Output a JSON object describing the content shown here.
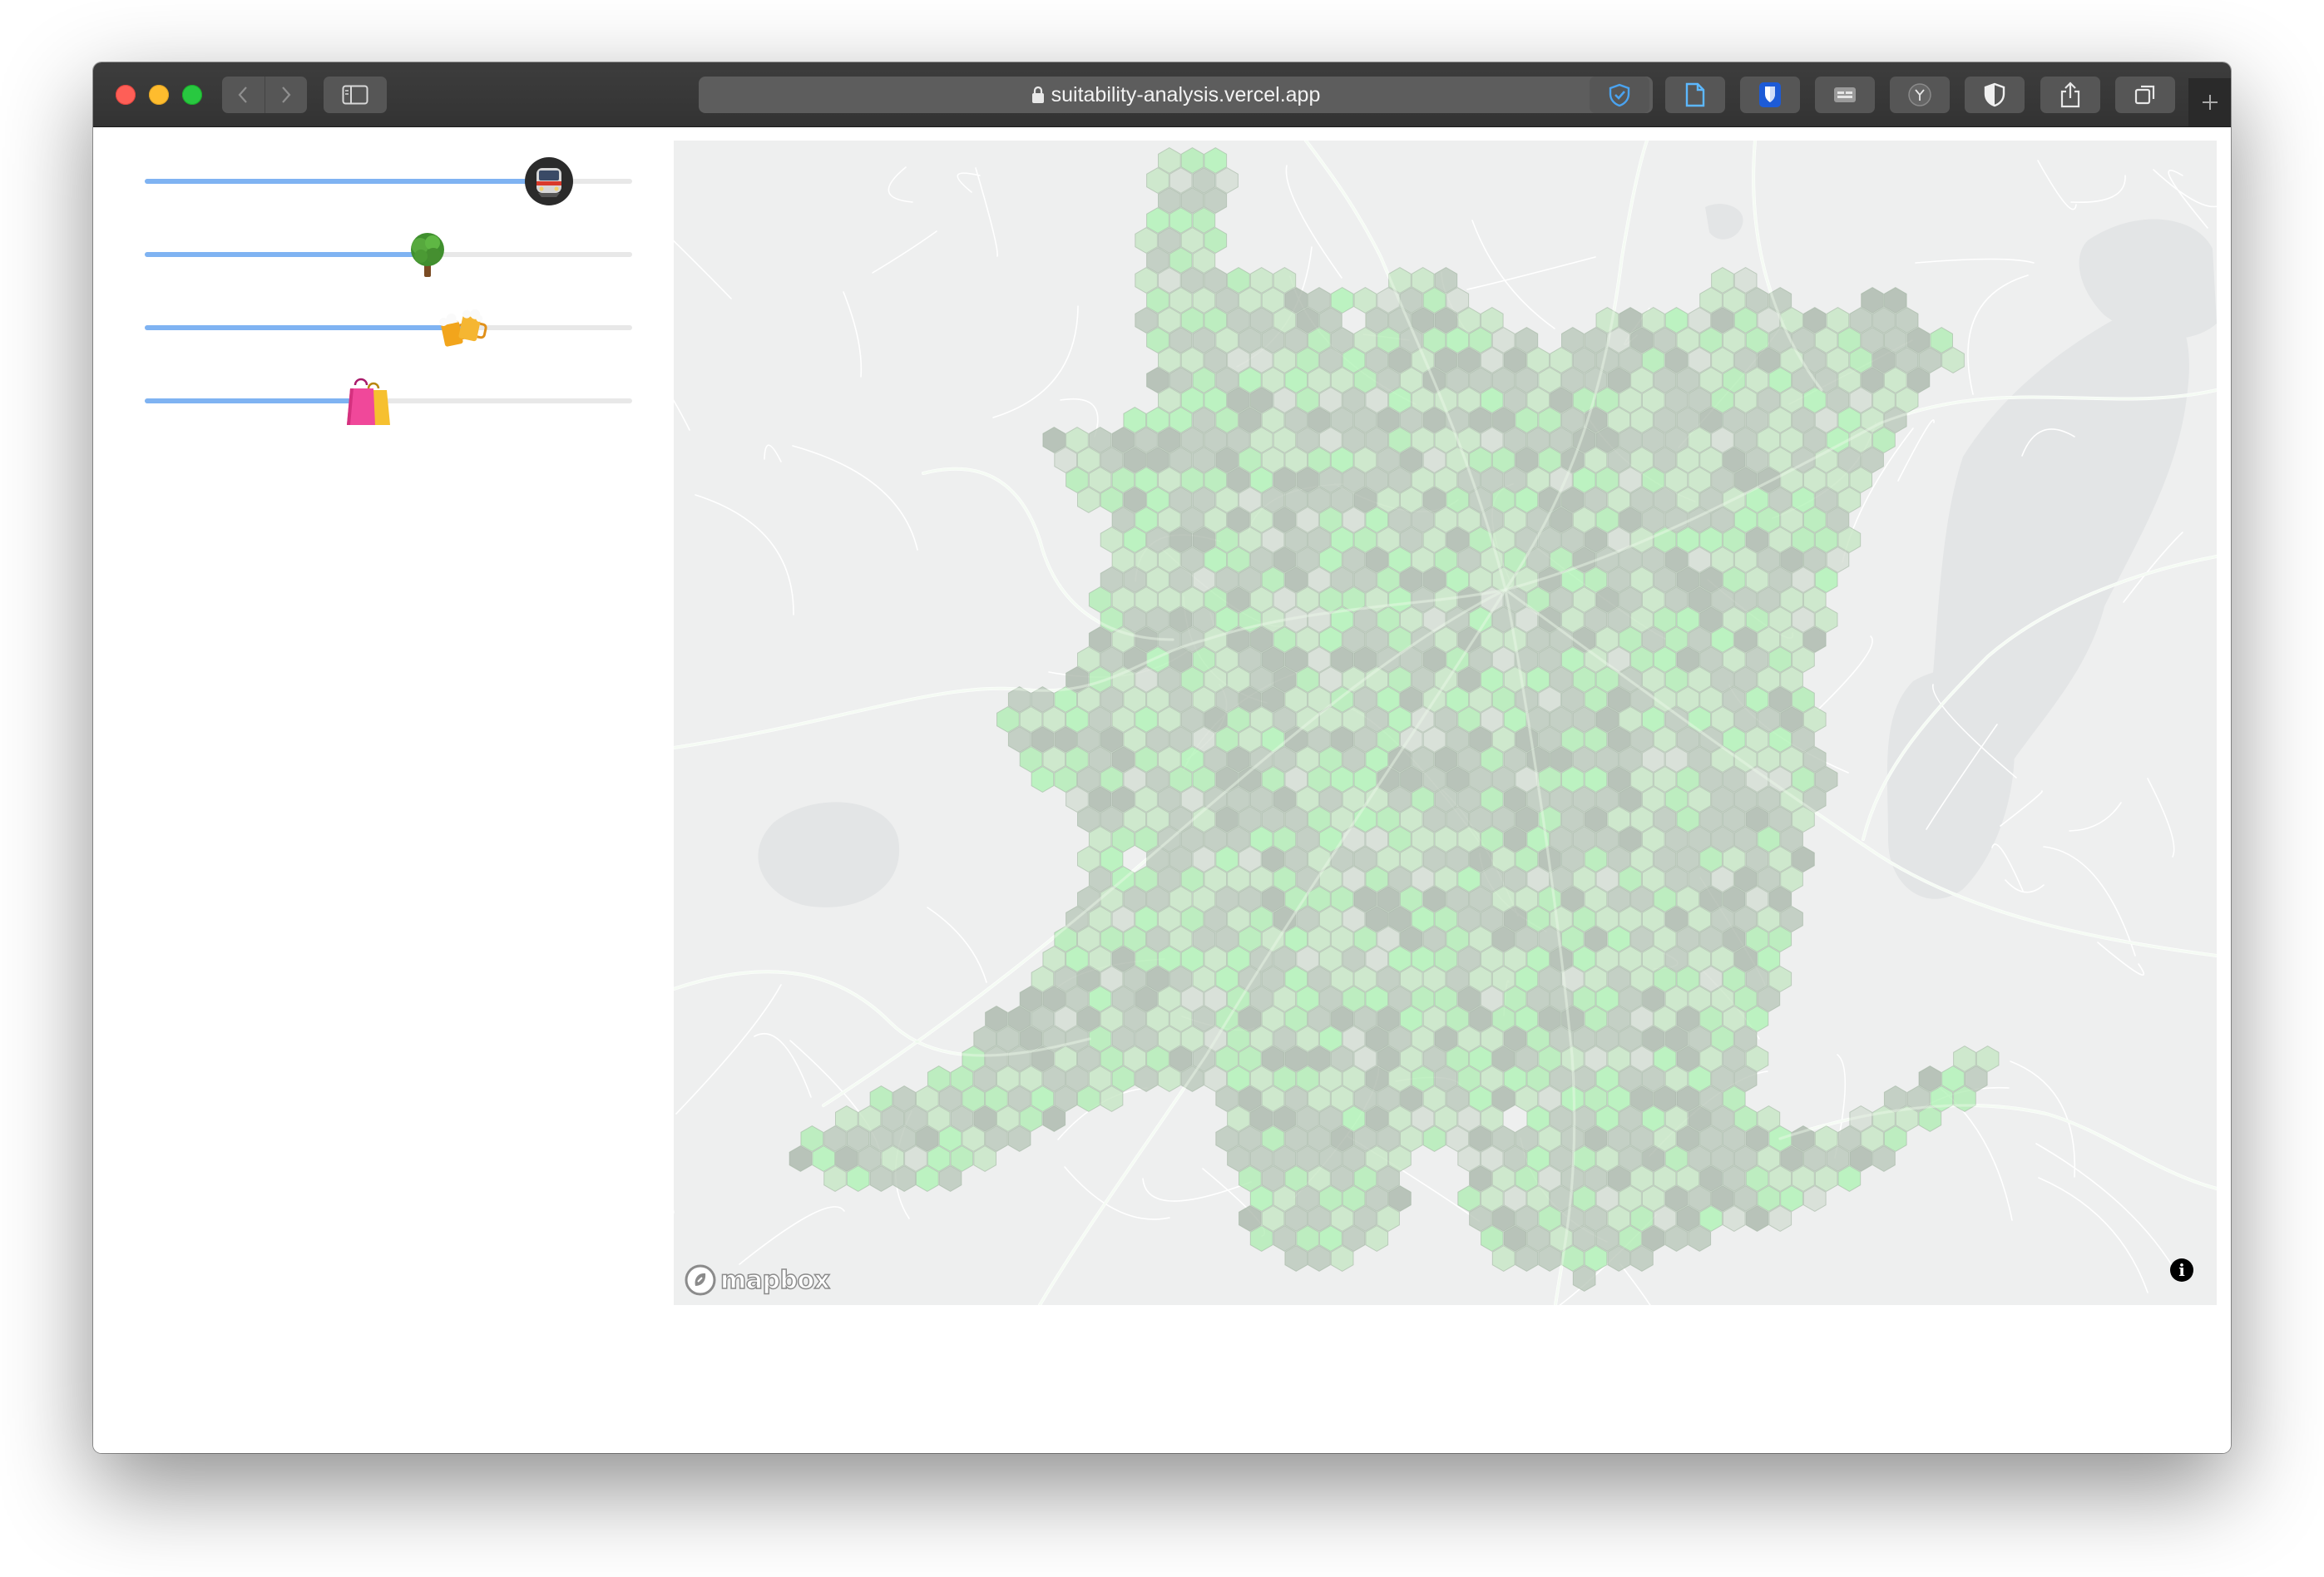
{
  "browser": {
    "url": "suitability-analysis.vercel.app"
  },
  "sliders": [
    {
      "id": "transit",
      "icon": "train-emoji-icon",
      "value": 0.83
    },
    {
      "id": "green",
      "icon": "tree-emoji-icon",
      "value": 0.58
    },
    {
      "id": "bars",
      "icon": "beer-mugs-emoji-icon",
      "value": 0.65
    },
    {
      "id": "shopping",
      "icon": "shopping-bags-emoji-icon",
      "value": 0.46
    }
  ],
  "map": {
    "attribution_logo": "mapbox",
    "info_glyph": "i",
    "hex_colors": [
      "#b9c7b9",
      "#a9b6a9",
      "#c5e6c3",
      "#b0ecb2",
      "#aef2b3",
      "#d4ddd2"
    ]
  }
}
